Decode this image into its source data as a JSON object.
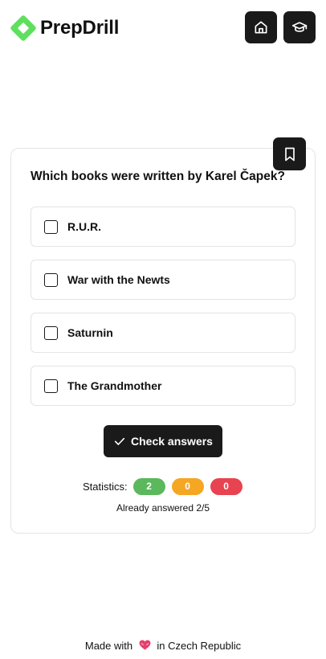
{
  "app": {
    "name": "PrepDrill"
  },
  "header": {
    "home_icon": "home-icon",
    "graduation_icon": "graduation-cap-icon"
  },
  "quiz": {
    "bookmark_icon": "bookmark-icon",
    "question": "Which books were written by Karel Čapek?",
    "options": [
      {
        "label": "R.U.R.",
        "checked": false
      },
      {
        "label": "War with the Newts",
        "checked": false
      },
      {
        "label": "Saturnin",
        "checked": false
      },
      {
        "label": "The Grandmother",
        "checked": false
      }
    ],
    "check_button_label": "Check answers"
  },
  "stats": {
    "label": "Statistics:",
    "correct": "2",
    "partial": "0",
    "wrong": "0",
    "answered_text": "Already answered 2/5"
  },
  "footer": {
    "made_with": "Made with",
    "location": "in Czech Republic"
  },
  "colors": {
    "brand_green": "#5ee05e",
    "dark": "#1a1a1a",
    "stat_green": "#5cb85c",
    "stat_orange": "#f5a623",
    "stat_red": "#e84350"
  }
}
